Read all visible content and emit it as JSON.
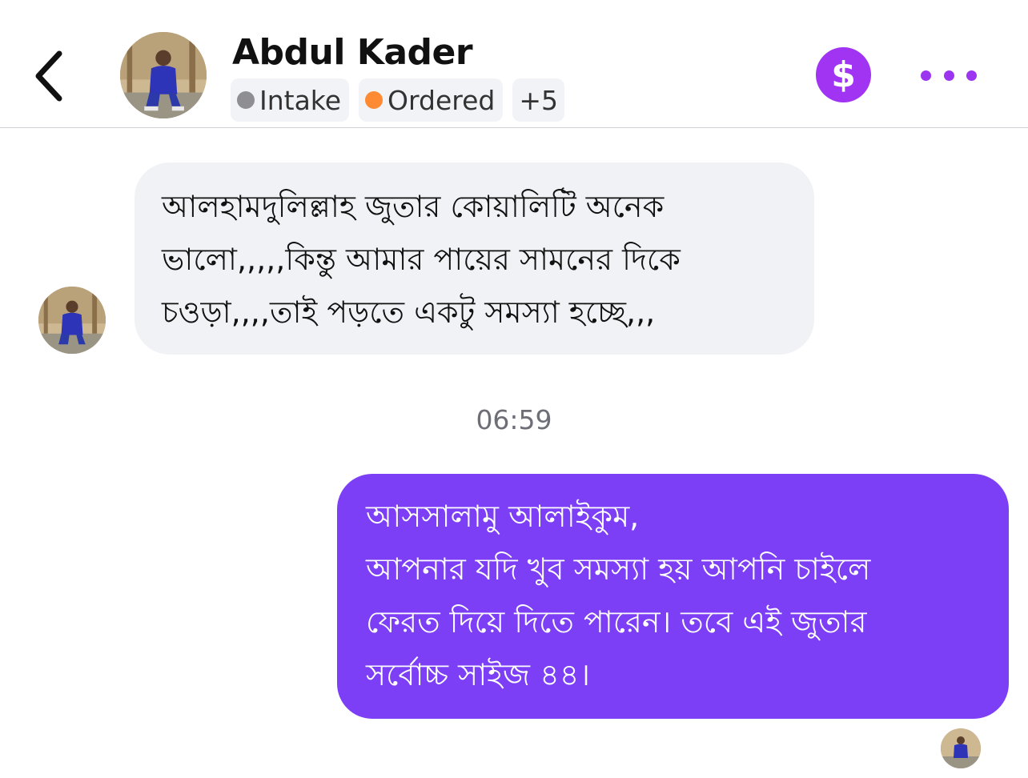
{
  "header": {
    "back_icon": "chevron-left-icon",
    "contact_name": "Abdul Kader",
    "avatar_icon": "contact-avatar",
    "tags": [
      {
        "label": "Intake",
        "dot_color": "#8e8e93"
      },
      {
        "label": "Ordered",
        "dot_color": "#ff8a34"
      }
    ],
    "more_tags_label": "+5",
    "payment_icon": "dollar-icon",
    "payment_symbol": "$",
    "menu_icon": "more-horizontal-icon"
  },
  "messages": [
    {
      "direction": "incoming",
      "text": "আলহামদুলিল্লাহ জুতার কোয়ালিটি অনেক\nভালো,,,,,কিন্তু আমার পায়ের সামনের  দিকে\nচওড়া,,,,তাই পড়তে একটু সমস্যা হচ্ছে,,,"
    },
    {
      "direction": "outgoing",
      "text": "আসসালামু আলাইকুম,\nআপনার যদি খুব সমস্যা হয় আপনি চাইলে\nফেরত দিয়ে দিতে পারেন। তবে এই জুতার\nসর্বোচ্চ সাইজ ৪৪।"
    }
  ],
  "timestamp": "06:59",
  "colors": {
    "accent": "#7b3ff2",
    "outgoing_bubble": "#7d3ff5",
    "incoming_bubble": "#f1f2f5",
    "dollar_button": "#a034f2",
    "menu_dots": "#9b35f0"
  }
}
